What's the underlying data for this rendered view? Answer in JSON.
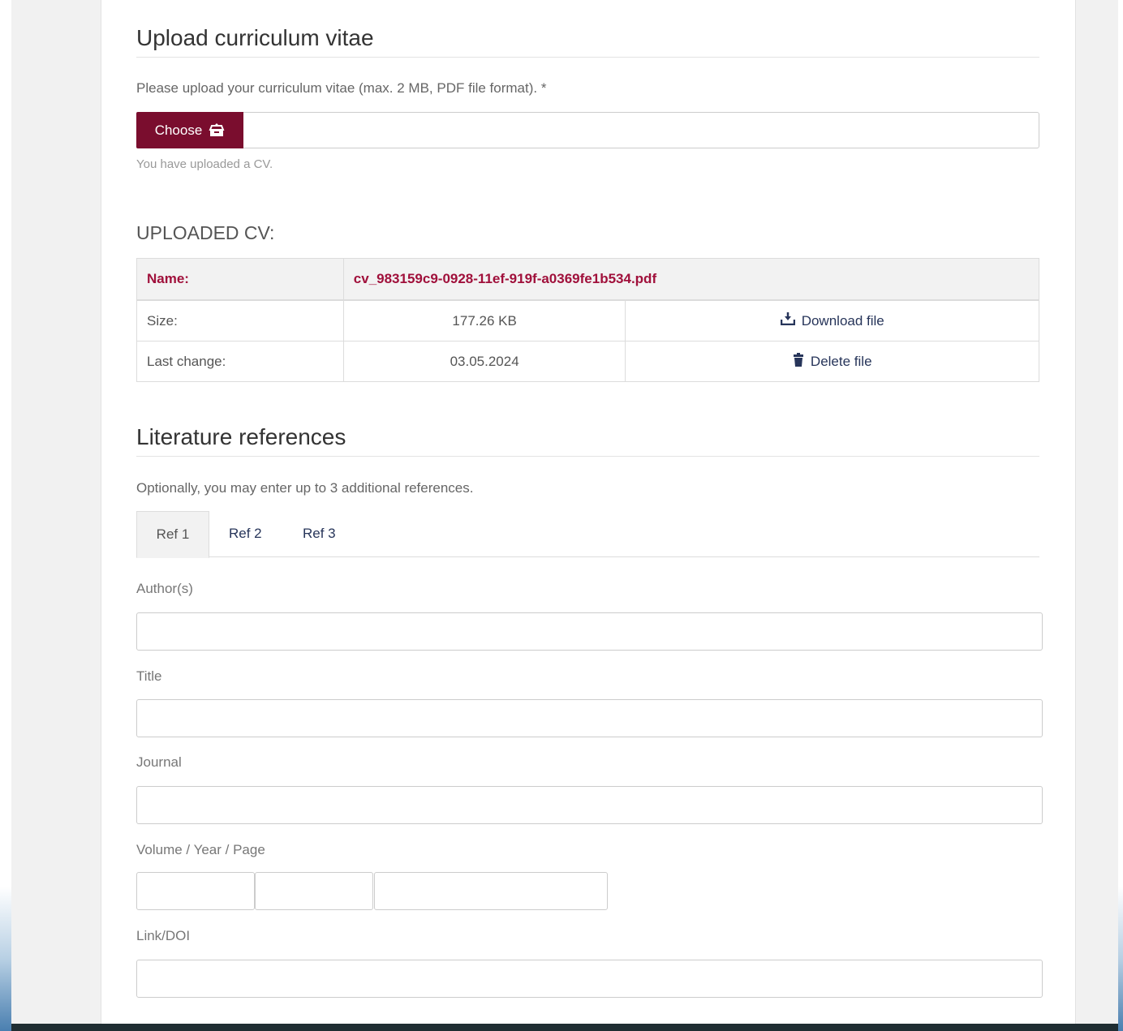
{
  "cv_section": {
    "title": "Upload curriculum vitae",
    "help_text": "Please upload your curriculum vitae (max. 2 MB, PDF file format). *",
    "choose_label": "Choose",
    "status_text": "You have uploaded a CV."
  },
  "uploaded_cv": {
    "heading": "UPLOADED CV:",
    "name_label": "Name:",
    "name_value": "cv_983159c9-0928-11ef-919f-a0369fe1b534.pdf",
    "size_label": "Size:",
    "size_value": "177.26 KB",
    "download_label": "Download file",
    "last_change_label": "Last change:",
    "last_change_value": "03.05.2024",
    "delete_label": "Delete file"
  },
  "literature": {
    "title": "Literature references",
    "help_text": "Optionally, you may enter up to 3 additional references.",
    "tabs": [
      {
        "label": "Ref 1",
        "active": true
      },
      {
        "label": "Ref 2",
        "active": false
      },
      {
        "label": "Ref 3",
        "active": false
      }
    ],
    "fields": {
      "authors_label": "Author(s)",
      "authors_value": "",
      "title_label": "Title",
      "title_value": "",
      "journal_label": "Journal",
      "journal_value": "",
      "vyp_label": "Volume / Year / Page",
      "volume_value": "",
      "year_value": "",
      "page_value": "",
      "link_label": "Link/DOI",
      "link_value": ""
    }
  },
  "colors": {
    "accent": "#7a0d2e",
    "name_text": "#a0103b",
    "link": "#27355a"
  },
  "icons": {
    "choose": "upload-box-icon",
    "download": "download-icon",
    "delete": "trash-icon"
  }
}
